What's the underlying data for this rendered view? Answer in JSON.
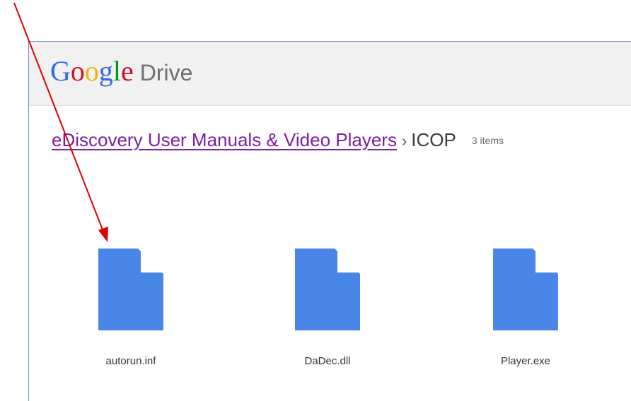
{
  "header": {
    "logo_letters": [
      {
        "char": "G",
        "color": "#3369e8"
      },
      {
        "char": "o",
        "color": "#d50f25"
      },
      {
        "char": "o",
        "color": "#eeb211"
      },
      {
        "char": "g",
        "color": "#3369e8"
      },
      {
        "char": "l",
        "color": "#009925"
      },
      {
        "char": "e",
        "color": "#d50f25"
      }
    ],
    "product_name": "Drive"
  },
  "breadcrumb": {
    "parent": "eDiscovery User Manuals & Video Players",
    "separator": "›",
    "current": "ICOP",
    "item_count": "3 items"
  },
  "files": [
    {
      "name": "autorun.inf",
      "icon": "file-icon"
    },
    {
      "name": "DaDec.dll",
      "icon": "file-icon"
    },
    {
      "name": "Player.exe",
      "icon": "file-icon"
    }
  ],
  "colors": {
    "file_icon": "#4a86e8",
    "annotation_arrow": "#e00000",
    "breadcrumb_link": "#7b1fa2"
  }
}
